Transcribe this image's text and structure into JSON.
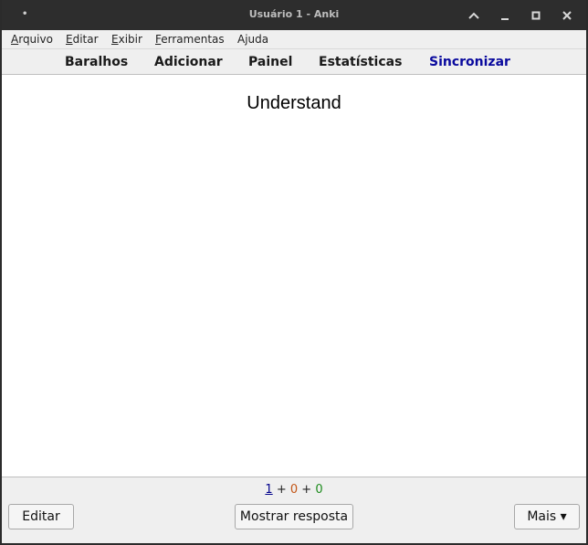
{
  "window": {
    "title": "Usuário 1 - Anki",
    "dot": "•"
  },
  "menu": {
    "items": [
      {
        "mnemonic": "A",
        "rest": "rquivo"
      },
      {
        "mnemonic": "E",
        "rest": "ditar"
      },
      {
        "mnemonic": "E",
        "rest": "xibir"
      },
      {
        "mnemonic": "F",
        "rest": "erramentas"
      },
      {
        "mnemonic": "",
        "rest": "Ajuda"
      }
    ]
  },
  "toolbar": {
    "decks": "Baralhos",
    "add": "Adicionar",
    "browse": "Painel",
    "stats": "Estatísticas",
    "sync": "Sincronizar"
  },
  "card": {
    "question": "Understand"
  },
  "counts": {
    "new": "1",
    "sep1": " + ",
    "learning": "0",
    "sep2": " + ",
    "review": "0"
  },
  "buttons": {
    "edit": "Editar",
    "show_answer": "Mostrar resposta",
    "more": "Mais ▾"
  },
  "colors": {
    "titlebar": "#2d2d2d",
    "sync_active": "#0a0a9e",
    "count_new": "#00008b",
    "count_learning": "#c35617",
    "count_review": "#1e8c1e"
  }
}
